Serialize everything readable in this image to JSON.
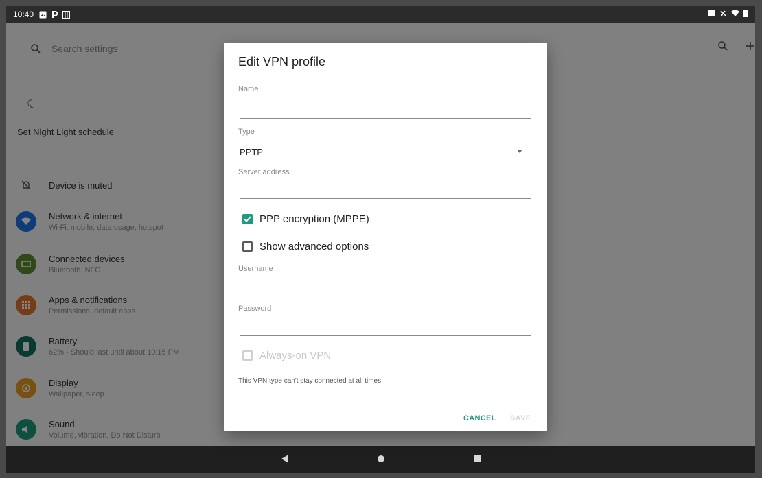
{
  "status_bar": {
    "time": "10:40"
  },
  "settings": {
    "search_placeholder": "Search settings",
    "night_light": "Set Night Light schedule",
    "muted": "Device is muted",
    "items": [
      {
        "title": "Network & internet",
        "subtitle": "Wi-Fi, mobile, data usage, hotspot",
        "color": "#1a73e8"
      },
      {
        "title": "Connected devices",
        "subtitle": "Bluetooth, NFC",
        "color": "#5a8f2e"
      },
      {
        "title": "Apps & notifications",
        "subtitle": "Permissions, default apps",
        "color": "#e0762a"
      },
      {
        "title": "Battery",
        "subtitle": "62% - Should last until about 10:15 PM",
        "color": "#12705e"
      },
      {
        "title": "Display",
        "subtitle": "Wallpaper, sleep",
        "color": "#e59c1f"
      },
      {
        "title": "Sound",
        "subtitle": "Volume, vibration, Do Not Disturb",
        "color": "#1a9a7a"
      }
    ]
  },
  "dialog": {
    "title": "Edit VPN profile",
    "name_label": "Name",
    "name_value": "",
    "type_label": "Type",
    "type_value": "PPTP",
    "server_label": "Server address",
    "server_value": "",
    "ppp_label": "PPP encryption (MPPE)",
    "ppp_checked": true,
    "advanced_label": "Show advanced options",
    "advanced_checked": false,
    "username_label": "Username",
    "password_label": "Password",
    "always_on_label": "Always-on VPN",
    "always_on_note": "This VPN type can't stay connected at all times",
    "cancel_label": "CANCEL",
    "save_label": "SAVE"
  },
  "accent_color": "#1e9a7e"
}
